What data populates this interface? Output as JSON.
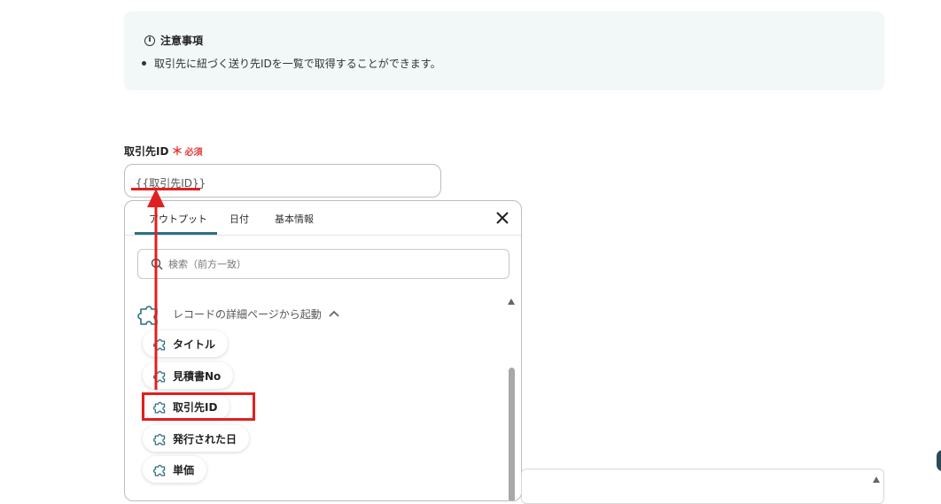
{
  "notice": {
    "title": "注意事項",
    "items": [
      "取引先に紐づく送り先IDを一覧で取得することができます。"
    ]
  },
  "field": {
    "label": "取引先ID",
    "required_mark": "＊",
    "required_text": "必須",
    "value": "{{取引先ID}}"
  },
  "popup": {
    "tabs": [
      {
        "label": "アウトプット",
        "active": true
      },
      {
        "label": "日付",
        "active": false
      },
      {
        "label": "基本情報",
        "active": false
      }
    ],
    "search_placeholder": "検索（前方一致）",
    "group_title": "レコードの詳細ページから起動",
    "items": [
      "タイトル",
      "見積書No",
      "取引先ID",
      "発行された日",
      "単価"
    ],
    "highlighted_item": "取引先ID"
  },
  "colors": {
    "accent": "#2a6f86",
    "annotation_red": "#e02020",
    "notice_bg": "#f1f8f7",
    "required": "#e23b3b"
  },
  "icons": {
    "info": "info-circle-icon",
    "close": "close-icon",
    "search": "search-icon",
    "puzzle": "puzzle-piece-icon",
    "chevron": "chevron-up-icon"
  }
}
